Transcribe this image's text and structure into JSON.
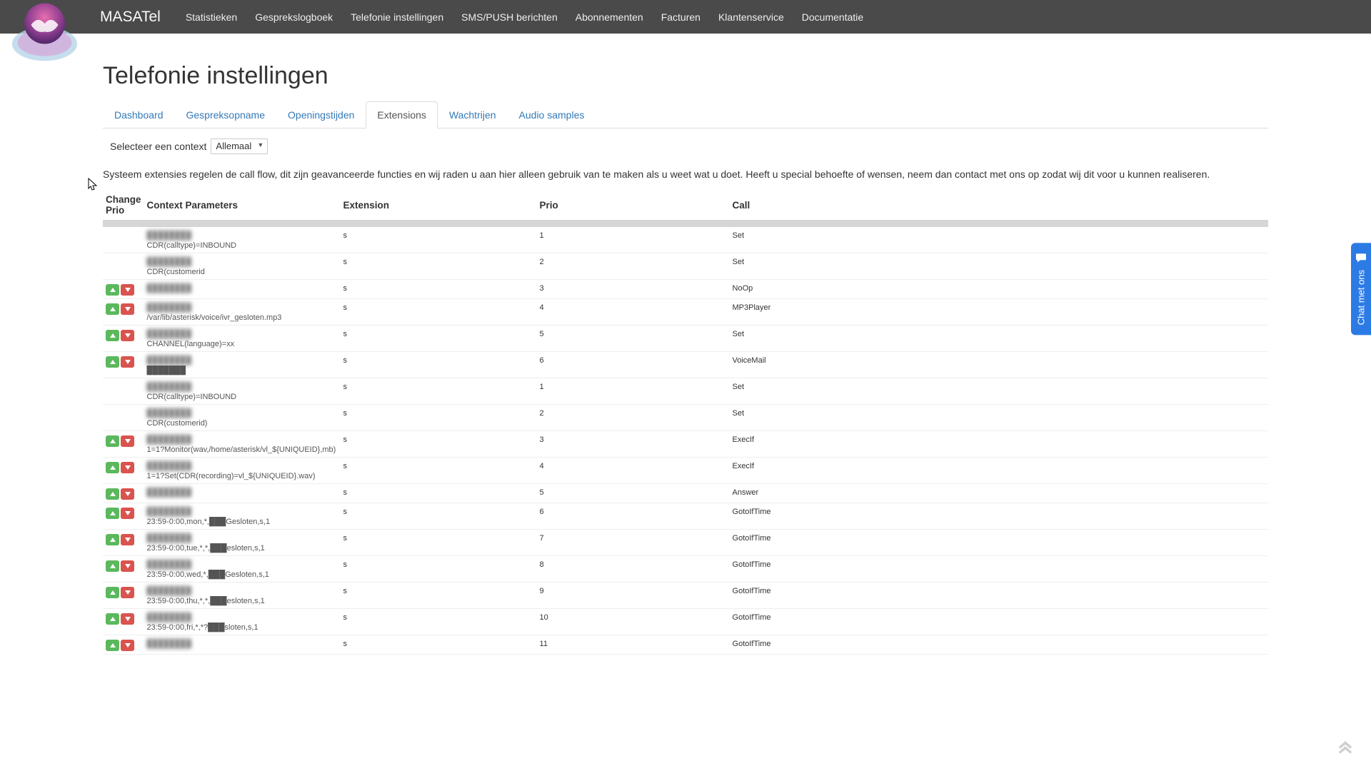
{
  "brand": "MASATel",
  "nav": [
    "Statistieken",
    "Gesprekslogboek",
    "Telefonie instellingen",
    "SMS/PUSH berichten",
    "Abonnementen",
    "Facturen",
    "Klantenservice",
    "Documentatie"
  ],
  "page_title": "Telefonie instellingen",
  "tabs": [
    {
      "label": "Dashboard",
      "active": false
    },
    {
      "label": "Gespreksopname",
      "active": false
    },
    {
      "label": "Openingstijden",
      "active": false
    },
    {
      "label": "Extensions",
      "active": true
    },
    {
      "label": "Wachtrijen",
      "active": false
    },
    {
      "label": "Audio samples",
      "active": false
    }
  ],
  "context": {
    "label": "Selecteer een context",
    "selected": "Allemaal"
  },
  "description": "Systeem extensies regelen de call flow, dit zijn geavanceerde functies en wij raden u aan hier alleen gebruik van te maken als u weet wat u doet. Heeft u special behoefte of wensen, neem dan contact met ons op zodat wij dit voor u kunnen realiseren.",
  "columns": {
    "change_prio": "Change Prio",
    "context": "Context Parameters",
    "extension": "Extension",
    "prio": "Prio",
    "call": "Call"
  },
  "rows": [
    {
      "up_down": false,
      "blur1": "████████",
      "param": "CDR(calltype)=INBOUND",
      "ext": "s",
      "prio": "1",
      "call": "Set"
    },
    {
      "up_down": false,
      "blur1": "████████",
      "param": "CDR(customerid",
      "ext": "s",
      "prio": "2",
      "call": "Set"
    },
    {
      "up_down": true,
      "blur1": "████████",
      "param": "",
      "ext": "s",
      "prio": "3",
      "call": "NoOp"
    },
    {
      "up_down": true,
      "blur1": "████████",
      "param": "/var/lib/asterisk/voice/ivr_gesloten.mp3",
      "ext": "s",
      "prio": "4",
      "call": "MP3Player"
    },
    {
      "up_down": true,
      "blur1": "████████",
      "param": "CHANNEL(language)=xx",
      "ext": "s",
      "prio": "5",
      "call": "Set"
    },
    {
      "up_down": true,
      "blur1": "████████",
      "param": "███████",
      "ext": "s",
      "prio": "6",
      "call": "VoiceMail"
    },
    {
      "up_down": false,
      "blur1": "████████",
      "param": "CDR(calltype)=INBOUND",
      "ext": "s",
      "prio": "1",
      "call": "Set"
    },
    {
      "up_down": false,
      "blur1": "████████",
      "param": "CDR(customerid)",
      "ext": "s",
      "prio": "2",
      "call": "Set"
    },
    {
      "up_down": true,
      "blur1": "████████",
      "param": "1=1?Monitor(wav,/home/asterisk/vl_${UNIQUEID},mb)",
      "ext": "s",
      "prio": "3",
      "call": "ExecIf"
    },
    {
      "up_down": true,
      "blur1": "████████",
      "param": "1=1?Set(CDR(recording)=vl_${UNIQUEID}.wav)",
      "ext": "s",
      "prio": "4",
      "call": "ExecIf"
    },
    {
      "up_down": true,
      "blur1": "████████",
      "param": "",
      "ext": "s",
      "prio": "5",
      "call": "Answer"
    },
    {
      "up_down": true,
      "blur1": "████████",
      "param": "23:59-0:00,mon,*,███Gesloten,s,1",
      "ext": "s",
      "prio": "6",
      "call": "GotoIfTime"
    },
    {
      "up_down": true,
      "blur1": "████████",
      "param": "23:59-0:00,tue,*,*,███esloten,s,1",
      "ext": "s",
      "prio": "7",
      "call": "GotoIfTime"
    },
    {
      "up_down": true,
      "blur1": "████████",
      "param": "23:59-0:00,wed,*,███Gesloten,s,1",
      "ext": "s",
      "prio": "8",
      "call": "GotoIfTime"
    },
    {
      "up_down": true,
      "blur1": "████████",
      "param": "23:59-0:00,thu,*,*,███esloten,s,1",
      "ext": "s",
      "prio": "9",
      "call": "GotoIfTime"
    },
    {
      "up_down": true,
      "blur1": "████████",
      "param": "23:59-0:00,fri,*,*?███sloten,s,1",
      "ext": "s",
      "prio": "10",
      "call": "GotoIfTime"
    },
    {
      "up_down": true,
      "blur1": "████████",
      "param": "",
      "ext": "s",
      "prio": "11",
      "call": "GotoIfTime"
    }
  ],
  "chat_label": "Chat met ons",
  "colors": {
    "topbar": "#4a4a4a",
    "link": "#337ab7",
    "up": "#5cb85c",
    "down": "#d9534f",
    "chat": "#2c7be5"
  }
}
